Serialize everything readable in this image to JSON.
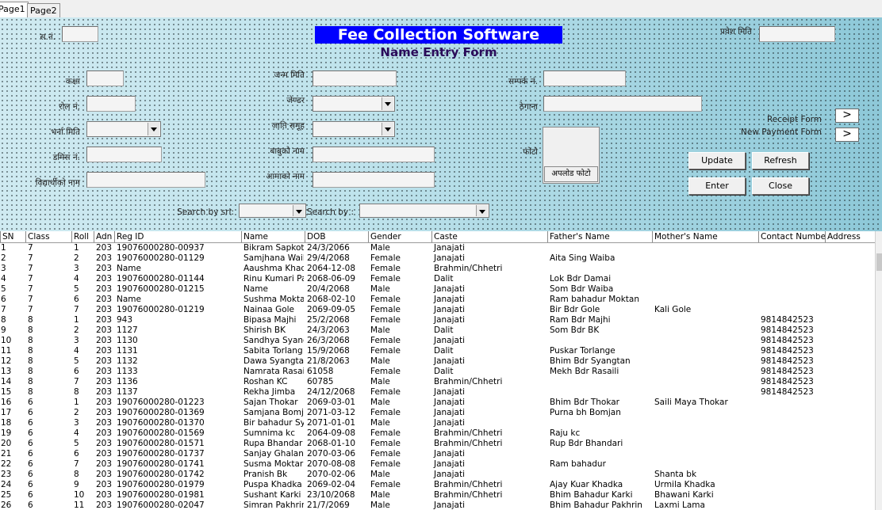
{
  "tabs": [
    "Page1",
    "Page2"
  ],
  "form": {
    "title": "Fee Collection Software",
    "subtitle": "Name Entry Form",
    "labels": {
      "sn": "स.नं.",
      "pravesh_miti": "प्रवेश मिति",
      "kaksha": "कक्षा",
      "roll": "रोल नं.",
      "janma_miti_bs": "जन्म मिति",
      "gender": "जेण्डर",
      "sampark": "सम्पर्क नं.",
      "thegana": "ठेगाना",
      "bharna_miti": "भर्ना मिति",
      "jati": "जाति समूह",
      "admission_no": "डमिस नं.",
      "father": "बाबुको नाम",
      "photo": "फोटो",
      "student_name": "विद्यार्थीको नाम",
      "mother": "आमाको नाम",
      "receipt_form": "Receipt Form",
      "new_payment_form": "New Payment Form",
      "search_by_srl": "Search by srl:",
      "search_by": "Search by :"
    },
    "buttons": {
      "update": "Update",
      "refresh": "Refresh",
      "enter": "Enter",
      "close": "Close",
      "upload_photo": "अपलोड फोटो",
      "receipt_arrow": ">",
      "payment_arrow": ">"
    }
  },
  "table": {
    "columns": [
      "SN",
      "Class",
      "Roll",
      "Adn",
      "Reg ID",
      "Name",
      "DOB",
      "Gender",
      "Caste",
      "Father's Name",
      "Mother's Name",
      "Contact Number",
      "Address"
    ],
    "rows": [
      [
        "1",
        "7",
        "1",
        "203",
        "19076000280-00937",
        "Bikram Sapkota",
        "24/3/2066",
        "Male",
        "Janajati",
        "",
        "",
        "",
        ""
      ],
      [
        "2",
        "7",
        "2",
        "203",
        "19076000280-01129",
        "Samjhana Waib",
        "29/4/2068",
        "Female",
        "Janajati",
        "Aita Sing Waiba",
        "",
        "",
        ""
      ],
      [
        "3",
        "7",
        "3",
        "203",
        "Name",
        "Aaushma Khad",
        "2064-12-08",
        "Female",
        "Brahmin/Chhetri",
        "",
        "",
        "",
        ""
      ],
      [
        "4",
        "7",
        "4",
        "203",
        "19076000280-01144",
        "Rinu Kumari Pa",
        "2068-06-09",
        "Female",
        "Dalit",
        "Lok Bdr Damai",
        "",
        "",
        ""
      ],
      [
        "5",
        "7",
        "5",
        "203",
        "19076000280-01215",
        "Name",
        "20/4/2068",
        "Male",
        "Janajati",
        "Som Bdr Waiba",
        "",
        "",
        ""
      ],
      [
        "6",
        "7",
        "6",
        "203",
        "Name",
        "Sushma  Mokta",
        "2068-02-10",
        "Female",
        "Janajati",
        "Ram bahadur Moktan",
        "",
        "",
        ""
      ],
      [
        "7",
        "7",
        "7",
        "203",
        "19076000280-01219",
        "Nainaa Gole",
        "2069-09-05",
        "Female",
        "Janajati",
        "Bir Bdr Gole",
        "Kali Gole",
        "",
        ""
      ],
      [
        "8",
        "8",
        "1",
        "203",
        "943",
        "Bipasa Majhi",
        "25/2/2068",
        "Female",
        "Janajati",
        "Ram Bdr Majhi",
        "",
        "9814842523",
        ""
      ],
      [
        "9",
        "8",
        "2",
        "203",
        "1127",
        "Shirish BK",
        "24/3/2063",
        "Male",
        "Dalit",
        "Som Bdr BK",
        "",
        "9814842523",
        ""
      ],
      [
        "10",
        "8",
        "3",
        "203",
        "1130",
        "Sandhya Syang",
        "26/3/2068",
        "Female",
        "Janajati",
        "",
        "",
        "9814842523",
        ""
      ],
      [
        "11",
        "8",
        "4",
        "203",
        "1131",
        "Sabita Torlang",
        "15/9/2068",
        "Female",
        "Dalit",
        "Puskar Torlange",
        "",
        "9814842523",
        ""
      ],
      [
        "12",
        "8",
        "5",
        "203",
        "1132",
        "Dawa Syangta",
        "21/8/2063",
        "Male",
        "Janajati",
        "Bhim Bdr Syangtan",
        "",
        "9814842523",
        ""
      ],
      [
        "13",
        "8",
        "6",
        "203",
        "1133",
        "Namrata Rasai",
        "61058",
        "Female",
        "Dalit",
        "Mekh Bdr Rasaili",
        "",
        "9814842523",
        ""
      ],
      [
        "14",
        "8",
        "7",
        "203",
        "1136",
        "Roshan KC",
        "60785",
        "Male",
        "Brahmin/Chhetri",
        "",
        "",
        "9814842523",
        ""
      ],
      [
        "15",
        "8",
        "8",
        "203",
        "1137",
        "Rekha Jimba",
        "24/12/2068",
        "Female",
        "Janajati",
        "",
        "",
        "9814842523",
        ""
      ],
      [
        "16",
        "6",
        "1",
        "203",
        "19076000280-01223",
        "Sajan Thokar",
        "2069-03-01",
        "Male",
        "Janajati",
        "Bhim Bdr Thokar",
        "Saili Maya Thokar",
        "",
        ""
      ],
      [
        "17",
        "6",
        "2",
        "203",
        "19076000280-01369",
        "Samjana Bomja",
        "2071-03-12",
        "Female",
        "Janajati",
        "Purna bh Bomjan",
        "",
        "",
        ""
      ],
      [
        "18",
        "6",
        "3",
        "203",
        "19076000280-01370",
        "Bir bahadur Sy",
        "2071-01-01",
        "Male",
        "Janajati",
        "",
        "",
        "",
        ""
      ],
      [
        "19",
        "6",
        "4",
        "203",
        "19076000280-01569",
        "Sumnima kc",
        "2064-09-08",
        "Female",
        "Brahmin/Chhetri",
        "Raju kc",
        "",
        "",
        ""
      ],
      [
        "20",
        "6",
        "5",
        "203",
        "19076000280-01571",
        "Rupa  Bhandar",
        "2068-01-10",
        "Female",
        "Brahmin/Chhetri",
        "Rup Bdr Bhandari",
        "",
        "",
        ""
      ],
      [
        "21",
        "6",
        "6",
        "203",
        "19076000280-01737",
        "Sanjay Ghalan",
        "2070-03-06",
        "Female",
        "Janajati",
        "",
        "",
        "",
        ""
      ],
      [
        "22",
        "6",
        "7",
        "203",
        "19076000280-01741",
        "Susma  Moktar",
        "2070-08-08",
        "Female",
        "Janajati",
        "Ram bahadur",
        "",
        "",
        ""
      ],
      [
        "23",
        "6",
        "8",
        "203",
        "19076000280-01742",
        "Pranish Bk",
        "2070-02-06",
        "Male",
        "Janajati",
        "",
        "Shanta bk",
        "",
        ""
      ],
      [
        "24",
        "6",
        "9",
        "203",
        "19076000280-01979",
        "Puspa  Khadka",
        "2069-02-04",
        "Female",
        "Brahmin/Chhetri",
        "Ajay Kuar Khadka",
        "Urmila Khadka",
        "",
        ""
      ],
      [
        "25",
        "6",
        "10",
        "203",
        "19076000280-01981",
        "Sushant  Karki",
        "23/10/2068",
        "Male",
        "Brahmin/Chhetri",
        "Bhim Bahadur Karki",
        "Bhawani Karki",
        "",
        ""
      ],
      [
        "26",
        "6",
        "11",
        "203",
        "19076000280-02047",
        "Simran Pakhrin",
        "21/7/2069",
        "Male",
        "Janajati",
        "Bhim Bahadur Pakhrin",
        "Laxmi Lama",
        "",
        ""
      ]
    ]
  }
}
